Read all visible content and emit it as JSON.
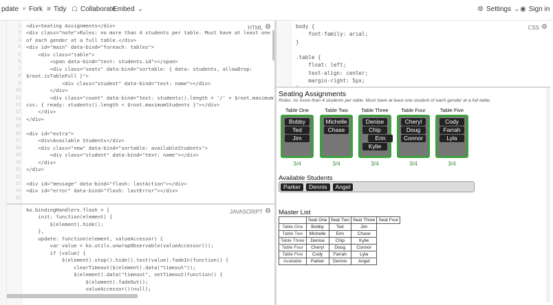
{
  "toolbar": {
    "update_label": "pdate",
    "fork_label": "Fork",
    "tidy_label": "Tidy",
    "collaborate_label": "Collaborate",
    "embed_label": "Embed",
    "settings_label": "Settings",
    "signin_label": "Sign in"
  },
  "panes": {
    "html_label": "HTML",
    "css_label": "CSS",
    "js_label": "JAVASCRIPT"
  },
  "html_code": "<div>Seating Assignments</div>\n<div class=\"note\">Rules: no more than 4 students per table. Must have at least one student\nof each gender at a full table.</div>\n<div id=\"main\" data-bind=\"foreach: tables\">\n    <div class=\"table\">\n        <span data-bind=\"text: students.id\"></span>\n        <div class=\"seats\" data-bind=\"sortable: { data: students, allowDrop:\n$root.isTableFull }\">\n            <div class=\"student\" data-bind=\"text: name\"></div>\n        </div>\n        <div class=\"count\" data-bind=\"text: students().length + '/' + $root.maximumStudents,\ncss: { ready: students().length < $root.maximumStudents }\"></div>\n    </div>\n</div>\n\n<div id=\"extra\">\n    <div>Available Students</div>\n    <div class=\"new\" data-bind=\"sortable: availableStudents\">\n        <div class=\"student\" data-bind=\"text: name\"></div>\n    </div>\n</div>\n\n<div id=\"message\" data-bind=\"flash: lastAction\"></div>\n<div id=\"error\" data-bind=\"flash: lastError\"></div>",
  "css_code": "body {\n    font-family: arial;\n}\n\n.table {\n    float: left;\n    text-align: center;\n    margin-right: 5px;\n}",
  "js_code": "ko.bindingHandlers.flash = {\n    init: function(element) {\n        $(element).hide();\n    },\n    update: function(element, valueAccessor) {\n        var value = ko.utils.unwrapObservable(valueAccessor());\n        if (value) {\n            $(element).stop().hide().text(value).fadeIn(function() {\n                clearTimeout($(element).data(\"timeout\"));\n                $(element).data(\"timeout\", setTimeout(function() {\n                    $(element).fadeOut();\n                    valueAccessor()(null);",
  "result": {
    "title": "Seating Assignments",
    "note": "Rules: no more than 4 students per table. Must have at least one student of each gender at a full table.",
    "tables": [
      {
        "label": "Table One",
        "students": [
          "Bobby",
          "Ted",
          "Jim"
        ],
        "count": "3/4"
      },
      {
        "label": "Table Two",
        "students": [
          "Michelle",
          "Chase"
        ],
        "count": "3/4"
      },
      {
        "label": "Table Three",
        "students": [
          "Denise",
          "Chip",
          "Erin",
          "Kylie"
        ],
        "count": "3/4"
      },
      {
        "label": "Table Four",
        "students": [
          "Cheryl",
          "Doug",
          "Connor"
        ],
        "count": "3/4"
      },
      {
        "label": "Table Five",
        "students": [
          "Cody",
          "Farrah",
          "Lyla"
        ],
        "count": "3/4"
      }
    ],
    "available_title": "Available Students",
    "available": [
      "Parker",
      "Dennis",
      "Angel"
    ],
    "master_title": "Master List",
    "master_headers": [
      "",
      "Seat One",
      "Seat Two",
      "Seat Three",
      "Seat Four"
    ],
    "master_rows": [
      [
        "Table One",
        "Bobby",
        "Ted",
        "Jim"
      ],
      [
        "Table Two",
        "Michelle",
        "Erin",
        "Chase"
      ],
      [
        "Table Three",
        "Denise",
        "Chip",
        "Kylie"
      ],
      [
        "Table Four",
        "Cheryl",
        "Doug",
        "Connor"
      ],
      [
        "Table Five",
        "Cody",
        "Farrah",
        "Lyla"
      ],
      [
        "Available",
        "Parker",
        "Dennis",
        "Angel"
      ]
    ]
  },
  "colors": {
    "accent_green": "#3aa23a",
    "student_bg": "#222222"
  }
}
